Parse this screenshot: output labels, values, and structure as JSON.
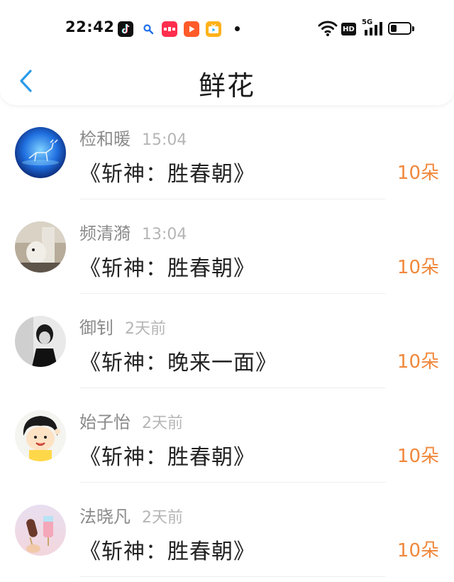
{
  "status_bar": {
    "time": "22:42",
    "hd_label": "HD",
    "network_label": "5G",
    "battery_level": 0.3,
    "apps": [
      {
        "icon": "tiktok-icon",
        "color": "#111111"
      },
      {
        "icon": "search-app-icon",
        "color": "#ffffff"
      },
      {
        "icon": "xiaohongshu-icon",
        "color": "#ff2e4d"
      },
      {
        "icon": "video-play-icon",
        "color": "#ff5a2a"
      },
      {
        "icon": "tv-app-icon",
        "color": "#ffb21a"
      }
    ]
  },
  "header": {
    "title": "鲜花",
    "back_icon": "chevron-left-icon",
    "accent_color": "#2a9ae8"
  },
  "colors": {
    "count": "#f0883c",
    "name": "#8a8a8a",
    "time": "#b5b5b5"
  },
  "records": [
    {
      "name": "检和暖",
      "time": "15:04",
      "gift": "《斩神：胜春朝》",
      "count": "10朵"
    },
    {
      "name": "频清漪",
      "time": "13:04",
      "gift": "《斩神：胜春朝》",
      "count": "10朵"
    },
    {
      "name": "御钊",
      "time": "2天前",
      "gift": "《斩神：晚来一面》",
      "count": "10朵"
    },
    {
      "name": "始子怡",
      "time": "2天前",
      "gift": "《斩神：胜春朝》",
      "count": "10朵"
    },
    {
      "name": "法晓凡",
      "time": "2天前",
      "gift": "《斩神：胜春朝》",
      "count": "10朵"
    }
  ]
}
